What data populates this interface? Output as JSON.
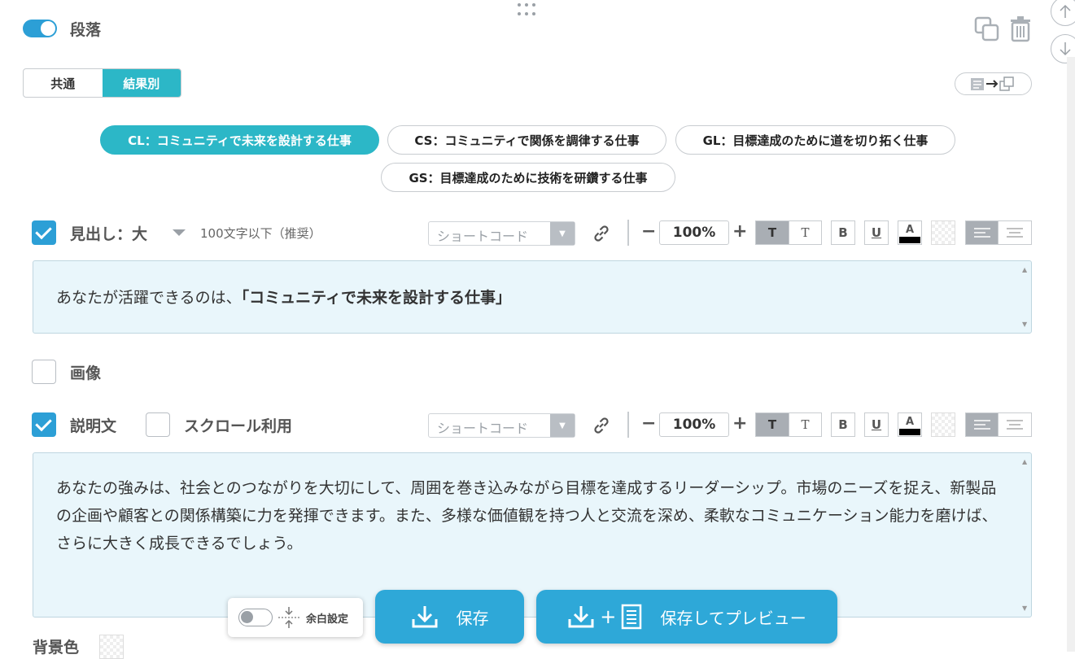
{
  "section": {
    "title": "段落",
    "toggle_on": true
  },
  "tabs": {
    "common": "共通",
    "by_result": "結果別",
    "active": "結果別"
  },
  "result_pills": [
    {
      "label": "CL：コミュニティで未来を設計する仕事",
      "active": true
    },
    {
      "label": "CS：コミュニティで関係を調律する仕事",
      "active": false
    },
    {
      "label": "GL：目標達成のために道を切り拓く仕事",
      "active": false
    },
    {
      "label": "GS：目標達成のために技術を研鑽する仕事",
      "active": false
    }
  ],
  "heading_field": {
    "label": "見出し：大",
    "hint": "100文字以下（推奨）",
    "checked": true,
    "value_normal": "あなたが活躍できるのは、",
    "value_bold": "「コミュニティで未来を設計する仕事」"
  },
  "image_field": {
    "label": "画像",
    "checked": false
  },
  "description_field": {
    "label": "説明文",
    "checked": true,
    "scroll_label": "スクロール利用",
    "scroll_checked": false,
    "value": "あなたの強みは、社会とのつながりを大切にして、周囲を巻き込みながら目標を達成するリーダーシップ。市場のニーズを捉え、新製品の企画や顧客との関係構築に力を発揮できます。また、多様な価値観を持つ人と交流を深め、柔軟なコミュニケーション能力を磨けば、さらに大きく成長できるでしょう。"
  },
  "toolbar": {
    "shortcode_placeholder": "ショートコード",
    "zoom": "100%",
    "minus": "−",
    "plus": "+",
    "t_serif": "T",
    "t_light": "T",
    "bold": "B",
    "underline": "U",
    "color": "A",
    "color_swatch": "#000000"
  },
  "background": {
    "label": "背景色"
  },
  "margin_setting": {
    "label": "余白設定",
    "toggle_on": false
  },
  "buttons": {
    "save": "保存",
    "save_preview": "保存してプレビュー",
    "plus": "+"
  },
  "colors": {
    "accent": "#2c9fd6",
    "teal": "#2cb7c7",
    "save_blue": "#2ea8d8",
    "textarea_bg": "#e9f6fb"
  }
}
